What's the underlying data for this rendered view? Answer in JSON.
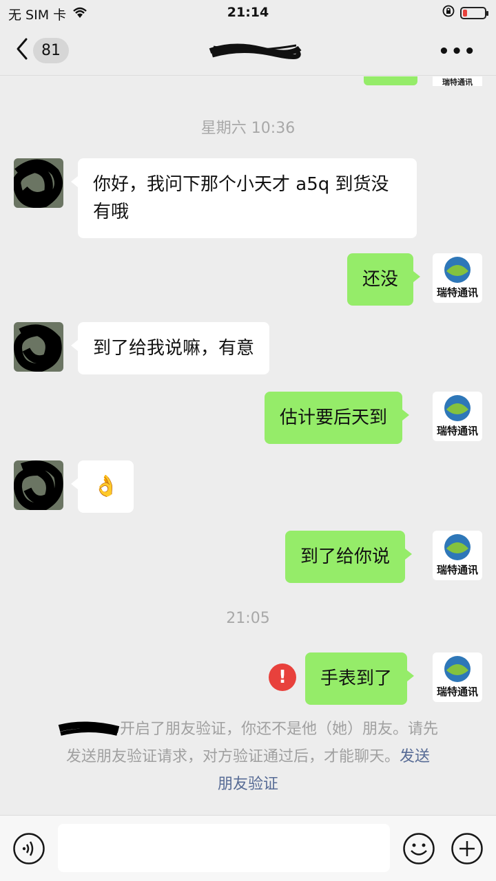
{
  "status_bar": {
    "carrier": "无 SIM 卡",
    "time": "21:14"
  },
  "nav": {
    "unread_count": "81",
    "more": "•••"
  },
  "avatar_brand": "瑞特通讯",
  "messages": [
    {
      "type": "time",
      "text": "星期六 10:36"
    },
    {
      "type": "in",
      "text": "你好，我问下那个小天才 a5q 到货没有哦"
    },
    {
      "type": "out",
      "text": "还没"
    },
    {
      "type": "in",
      "text": "到了给我说嘛，有意"
    },
    {
      "type": "out",
      "text": "估计要后天到"
    },
    {
      "type": "in",
      "text": "👌"
    },
    {
      "type": "out",
      "text": "到了给你说"
    },
    {
      "type": "time",
      "text": "21:05"
    },
    {
      "type": "out",
      "text": "手表到了",
      "status": "failed"
    }
  ],
  "notice": {
    "text_1": "开启了朋友验证，你还不是他（她）朋友。请先",
    "text_2": "发送朋友验证请求，对方验证通过后，才能聊天。",
    "link": "发送",
    "link_2": "朋友验证"
  },
  "error_mark": "!",
  "colors": {
    "outgoing_bubble": "#95ec69",
    "incoming_bubble": "#ffffff",
    "background": "#ededed",
    "link": "#576b95",
    "error": "#e8413c"
  },
  "icons": [
    "wifi-icon",
    "orientation-lock-icon",
    "battery-icon",
    "back-chevron-icon",
    "more-icon",
    "voice-icon",
    "emoji-icon",
    "plus-icon",
    "error-icon"
  ]
}
